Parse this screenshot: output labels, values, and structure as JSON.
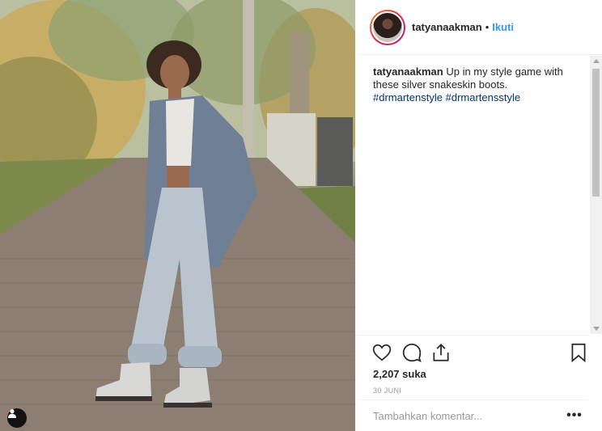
{
  "photo": {
    "description_icon": "tagged-user-icon"
  },
  "header": {
    "username": "tatyanaakman",
    "separator": "•",
    "follow_label": "Ikuti"
  },
  "caption": {
    "username": "tatyanaakman",
    "text": "Up in my style game with these silver snakeskin boots.",
    "hashtags": [
      "#drmartenstyle",
      "#drmartensstyle"
    ]
  },
  "actions": {
    "like_icon": "heart-icon",
    "comment_icon": "comment-icon",
    "share_icon": "share-icon",
    "save_icon": "bookmark-icon"
  },
  "likes": "2,207 suka",
  "date": "30 JUNI",
  "comment": {
    "placeholder": "Tambahkan komentar...",
    "more_label": "•••"
  },
  "colors": {
    "link_blue": "#3897f0",
    "hashtag": "#003569",
    "text": "#262626",
    "muted": "#999999"
  }
}
